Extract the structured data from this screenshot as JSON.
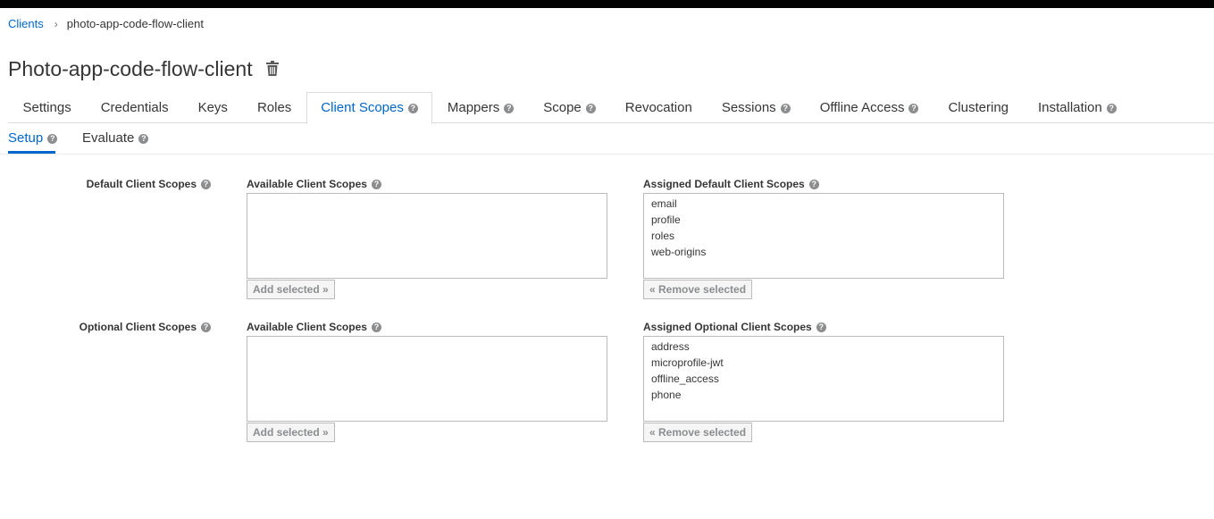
{
  "breadcrumb": {
    "parent": "Clients",
    "separator": "›",
    "current": "photo-app-code-flow-client"
  },
  "page": {
    "title": "Photo-app-code-flow-client"
  },
  "tabs": [
    {
      "label": "Settings",
      "help": false
    },
    {
      "label": "Credentials",
      "help": false
    },
    {
      "label": "Keys",
      "help": false
    },
    {
      "label": "Roles",
      "help": false
    },
    {
      "label": "Client Scopes",
      "help": true,
      "active": true
    },
    {
      "label": "Mappers",
      "help": true
    },
    {
      "label": "Scope",
      "help": true
    },
    {
      "label": "Revocation",
      "help": false
    },
    {
      "label": "Sessions",
      "help": true
    },
    {
      "label": "Offline Access",
      "help": true
    },
    {
      "label": "Clustering",
      "help": false
    },
    {
      "label": "Installation",
      "help": true
    }
  ],
  "subtabs": [
    {
      "label": "Setup",
      "active": true
    },
    {
      "label": "Evaluate"
    }
  ],
  "default_scopes": {
    "label": "Default Client Scopes",
    "available_label": "Available Client Scopes",
    "available_items": [],
    "assigned_label": "Assigned Default Client Scopes",
    "assigned_items": [
      "email",
      "profile",
      "roles",
      "web-origins"
    ],
    "add_button": "Add selected »",
    "remove_button": "« Remove selected"
  },
  "optional_scopes": {
    "label": "Optional Client Scopes",
    "available_label": "Available Client Scopes",
    "available_items": [],
    "assigned_label": "Assigned Optional Client Scopes",
    "assigned_items": [
      "address",
      "microprofile-jwt",
      "offline_access",
      "phone"
    ],
    "add_button": "Add selected »",
    "remove_button": "« Remove selected"
  },
  "colors": {
    "link": "#0066cc",
    "text": "#363636",
    "help_icon": "#8b8d8f",
    "topbar": "#030303"
  },
  "icons": {
    "delete": "trash-icon",
    "help": "question-circle-icon"
  }
}
